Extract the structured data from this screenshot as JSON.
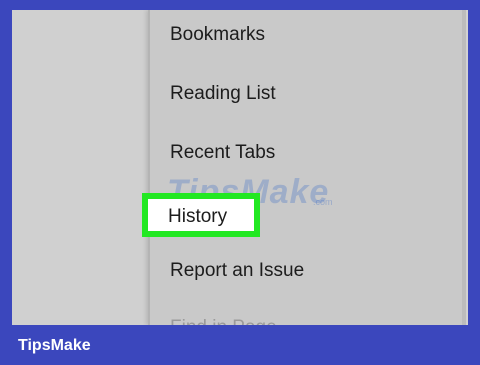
{
  "menu": {
    "items": [
      {
        "label": "Bookmarks"
      },
      {
        "label": "Reading List"
      },
      {
        "label": "Recent Tabs"
      },
      {
        "label": "History"
      },
      {
        "label": "Report an Issue"
      },
      {
        "label": "Find in Page"
      }
    ],
    "highlighted_item": "History"
  },
  "watermark": {
    "text": "TipsMake",
    "suffix": ".com"
  },
  "footer": {
    "brand": "TipsMake"
  },
  "colors": {
    "frame": "#3b47bd",
    "highlight": "#22e822",
    "menu_background": "#c9c9c9"
  }
}
